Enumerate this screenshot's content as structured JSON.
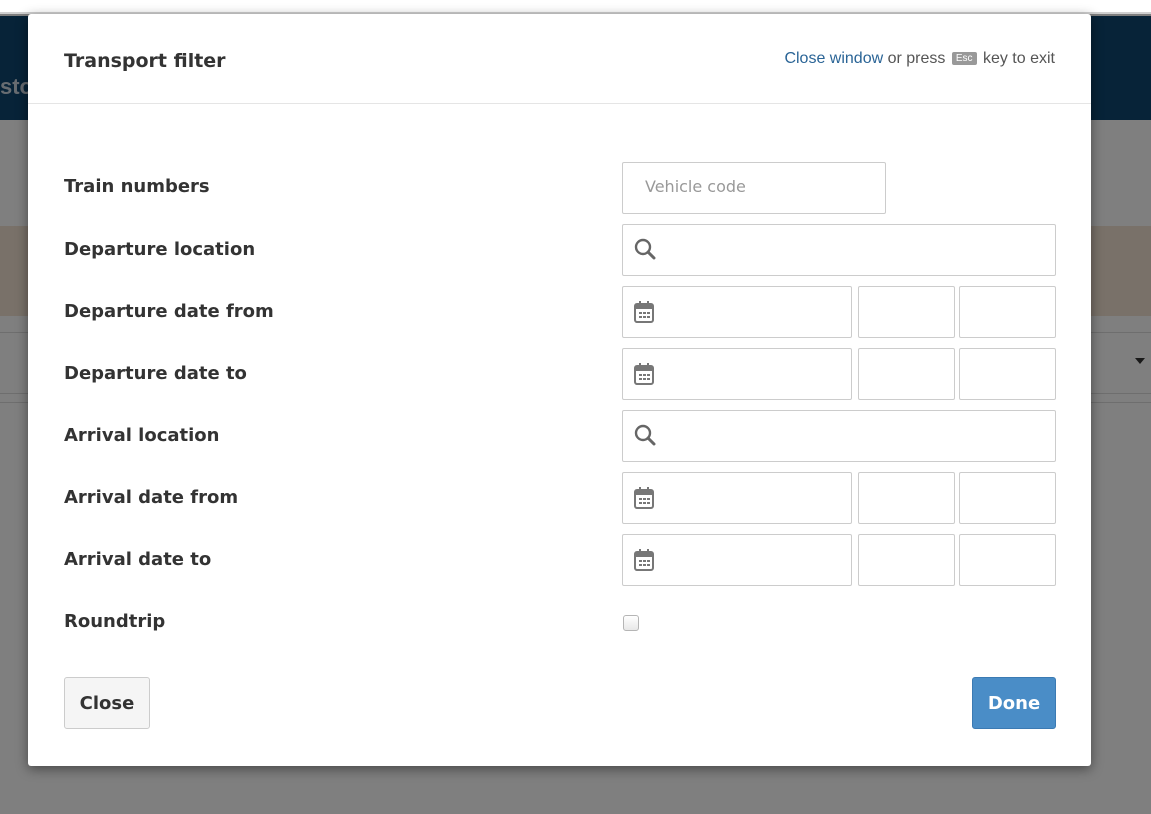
{
  "background": {
    "header_text": "sto"
  },
  "modal": {
    "title": "Transport filter",
    "hint": {
      "close_link": "Close window",
      "middle": " or press ",
      "key": "Esc",
      "suffix": " key to exit"
    }
  },
  "form": {
    "train_numbers": {
      "label": "Train numbers",
      "placeholder": "Vehicle code",
      "value": ""
    },
    "departure_location": {
      "label": "Departure location",
      "icon": "search-icon",
      "value": ""
    },
    "departure_date_from": {
      "label": "Departure date from",
      "icon": "calendar-icon",
      "date": "",
      "hour": "",
      "minute": ""
    },
    "departure_date_to": {
      "label": "Departure date to",
      "icon": "calendar-icon",
      "date": "",
      "hour": "",
      "minute": ""
    },
    "arrival_location": {
      "label": "Arrival location",
      "icon": "search-icon",
      "value": ""
    },
    "arrival_date_from": {
      "label": "Arrival date from",
      "icon": "calendar-icon",
      "date": "",
      "hour": "",
      "minute": ""
    },
    "arrival_date_to": {
      "label": "Arrival date to",
      "icon": "calendar-icon",
      "date": "",
      "hour": "",
      "minute": ""
    },
    "roundtrip": {
      "label": "Roundtrip",
      "checked": false
    }
  },
  "buttons": {
    "close": "Close",
    "done": "Done"
  },
  "colors": {
    "header_bg": "#0f4770",
    "link": "#2a6496",
    "primary_button": "#4a8dc7"
  }
}
